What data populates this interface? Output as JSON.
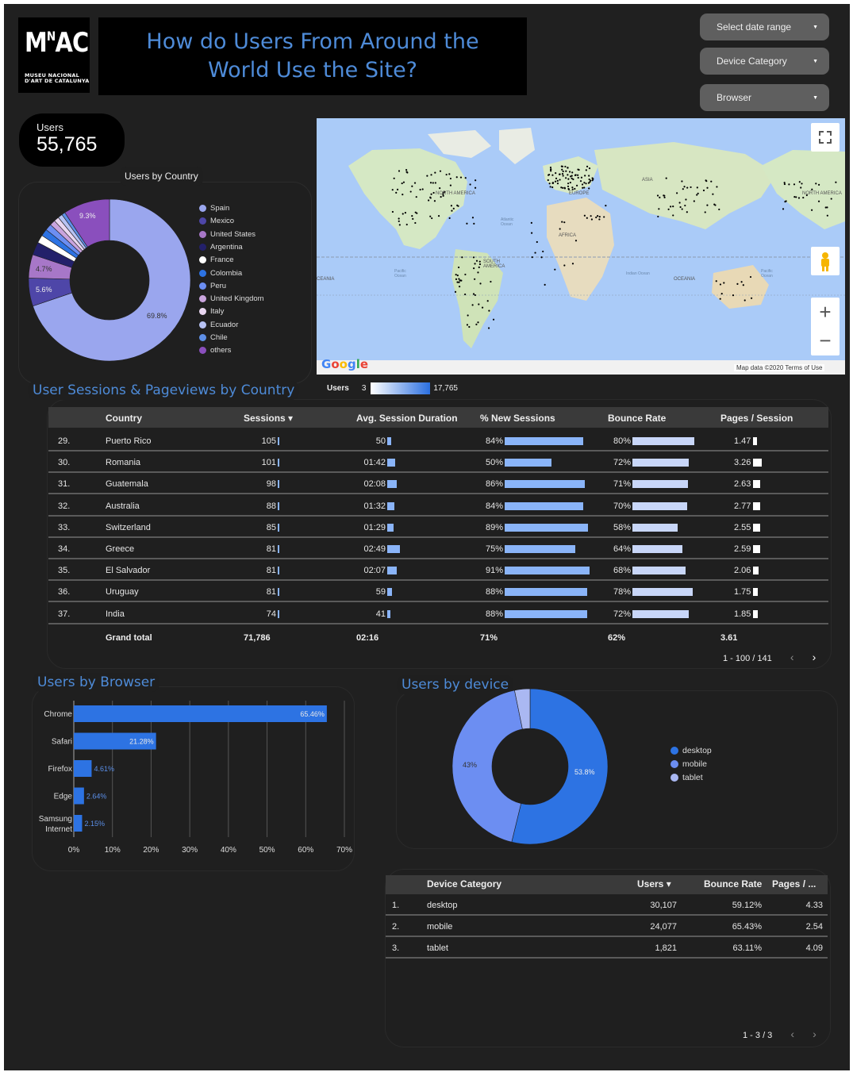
{
  "logo": {
    "big": "MNAC",
    "sup": "N",
    "line1": "MUSEU NACIONAL",
    "line2": "D'ART DE CATALUNYA"
  },
  "header": {
    "title": "How do Users From Around the World Use the Site?"
  },
  "filters": {
    "date_range": "Select date range",
    "device_category": "Device Category",
    "browser": "Browser"
  },
  "scorecard": {
    "label": "Users",
    "value": "55,765"
  },
  "users_by_country": {
    "title": "Users by Country",
    "slice_labels": [
      "69.8%",
      "5.6%",
      "4.7%",
      "9.3%"
    ],
    "legend": [
      {
        "name": "Spain",
        "color": "#9aa6ee"
      },
      {
        "name": "Mexico",
        "color": "#4e46a8"
      },
      {
        "name": "United States",
        "color": "#a777c8"
      },
      {
        "name": "Argentina",
        "color": "#23206a"
      },
      {
        "name": "France",
        "color": "#ffffff"
      },
      {
        "name": "Colombia",
        "color": "#2d73e3"
      },
      {
        "name": "Peru",
        "color": "#6c8ef2"
      },
      {
        "name": "United Kingdom",
        "color": "#c9a4dd"
      },
      {
        "name": "Italy",
        "color": "#e8d6f0"
      },
      {
        "name": "Ecuador",
        "color": "#b7c2f3"
      },
      {
        "name": "Chile",
        "color": "#5e8fe6"
      },
      {
        "name": "others",
        "color": "#8a4fbd"
      }
    ]
  },
  "map": {
    "labels": {
      "north_america": "NORTH AMERICA",
      "north_america_right": "NORTH AMERICA",
      "europe": "EUROPE",
      "asia": "ASIA",
      "africa": "AFRICA",
      "south_america": "SOUTH AMERICA",
      "oceania": "OCEANIA",
      "oceania_left": "CEANIA",
      "atlantic": "Atlantic Ocean",
      "pacific_left": "Pacific Ocean",
      "pacific_right": "Pacific Ocean",
      "indian": "Indian Ocean"
    },
    "google": "Google",
    "attribution": "Map data ©2020   Terms of Use",
    "legend_label": "Users",
    "legend_min": "3",
    "legend_max": "17,765"
  },
  "country_table": {
    "title": "User Sessions & Pageviews by Country",
    "headers": {
      "country": "Country",
      "sessions": "Sessions ▾",
      "duration": "Avg. Session Duration",
      "new_sessions": "% New Sessions",
      "bounce": "Bounce Rate",
      "pages": "Pages / Session"
    },
    "rows": [
      {
        "n": "29.",
        "country": "Puerto Rico",
        "sessions": "105",
        "duration": "50",
        "new": "84%",
        "new_v": 84,
        "bounce": "80%",
        "bounce_v": 80,
        "pages": "1.47",
        "pages_v": 1.47,
        "dur_s": 50
      },
      {
        "n": "30.",
        "country": "Romania",
        "sessions": "101",
        "duration": "01:42",
        "new": "50%",
        "new_v": 50,
        "bounce": "72%",
        "bounce_v": 72,
        "pages": "3.26",
        "pages_v": 3.26,
        "dur_s": 102
      },
      {
        "n": "31.",
        "country": "Guatemala",
        "sessions": "98",
        "duration": "02:08",
        "new": "86%",
        "new_v": 86,
        "bounce": "71%",
        "bounce_v": 71,
        "pages": "2.63",
        "pages_v": 2.63,
        "dur_s": 128
      },
      {
        "n": "32.",
        "country": "Australia",
        "sessions": "88",
        "duration": "01:32",
        "new": "84%",
        "new_v": 84,
        "bounce": "70%",
        "bounce_v": 70,
        "pages": "2.77",
        "pages_v": 2.77,
        "dur_s": 92
      },
      {
        "n": "33.",
        "country": "Switzerland",
        "sessions": "85",
        "duration": "01:29",
        "new": "89%",
        "new_v": 89,
        "bounce": "58%",
        "bounce_v": 58,
        "pages": "2.55",
        "pages_v": 2.55,
        "dur_s": 89
      },
      {
        "n": "34.",
        "country": "Greece",
        "sessions": "81",
        "duration": "02:49",
        "new": "75%",
        "new_v": 75,
        "bounce": "64%",
        "bounce_v": 64,
        "pages": "2.59",
        "pages_v": 2.59,
        "dur_s": 169
      },
      {
        "n": "35.",
        "country": "El Salvador",
        "sessions": "81",
        "duration": "02:07",
        "new": "91%",
        "new_v": 91,
        "bounce": "68%",
        "bounce_v": 68,
        "pages": "2.06",
        "pages_v": 2.06,
        "dur_s": 127
      },
      {
        "n": "36.",
        "country": "Uruguay",
        "sessions": "81",
        "duration": "59",
        "new": "88%",
        "new_v": 88,
        "bounce": "78%",
        "bounce_v": 78,
        "pages": "1.75",
        "pages_v": 1.75,
        "dur_s": 59
      },
      {
        "n": "37.",
        "country": "India",
        "sessions": "74",
        "duration": "41",
        "new": "88%",
        "new_v": 88,
        "bounce": "72%",
        "bounce_v": 72,
        "pages": "1.85",
        "pages_v": 1.85,
        "dur_s": 41
      }
    ],
    "grand_total": {
      "label": "Grand total",
      "sessions": "71,786",
      "duration": "02:16",
      "new": "71%",
      "bounce": "62%",
      "pages": "3.61"
    },
    "pagination": "1 - 100 / 141"
  },
  "users_by_browser": {
    "title": "Users by Browser",
    "chart_data": {
      "type": "bar",
      "categories": [
        "Chrome",
        "Safari",
        "Firefox",
        "Edge",
        "Samsung Internet"
      ],
      "values": [
        65.46,
        21.28,
        4.61,
        2.64,
        2.15
      ],
      "value_labels": [
        "65.46%",
        "21.28%",
        "4.61%",
        "2.64%",
        "2.15%"
      ],
      "xlim": [
        0,
        70
      ],
      "ticks": [
        "0%",
        "10%",
        "20%",
        "30%",
        "40%",
        "50%",
        "60%",
        "70%"
      ],
      "color": "#2d73e3",
      "orientation": "horizontal",
      "grid": true
    }
  },
  "users_by_device": {
    "title": "Users by device",
    "chart_data": {
      "type": "pie",
      "categories": [
        "desktop",
        "mobile",
        "tablet"
      ],
      "values": [
        53.8,
        43,
        3.2
      ],
      "value_labels": [
        "53.8%",
        "43%",
        ""
      ],
      "colors": [
        "#2d73e3",
        "#6c8ef2",
        "#aab8f2"
      ],
      "legend": "right"
    }
  },
  "device_table": {
    "headers": {
      "category": "Device Category",
      "users": "Users ▾",
      "bounce": "Bounce Rate",
      "pages": "Pages / ..."
    },
    "rows": [
      {
        "n": "1.",
        "category": "desktop",
        "users": "30,107",
        "bounce": "59.12%",
        "pages": "4.33"
      },
      {
        "n": "2.",
        "category": "mobile",
        "users": "24,077",
        "bounce": "65.43%",
        "pages": "2.54"
      },
      {
        "n": "3.",
        "category": "tablet",
        "users": "1,821",
        "bounce": "63.11%",
        "pages": "4.09"
      }
    ],
    "pagination": "1 - 3 / 3"
  },
  "users_by_country_chart": {
    "chart_data": {
      "type": "pie",
      "categories": [
        "Spain",
        "Mexico",
        "United States",
        "Argentina",
        "France",
        "Colombia",
        "Peru",
        "United Kingdom",
        "Italy",
        "Ecuador",
        "Chile",
        "others"
      ],
      "values": [
        69.8,
        5.6,
        4.7,
        2.6,
        1.6,
        1.4,
        1.3,
        1.1,
        1.0,
        0.9,
        0.7,
        9.3
      ]
    }
  }
}
